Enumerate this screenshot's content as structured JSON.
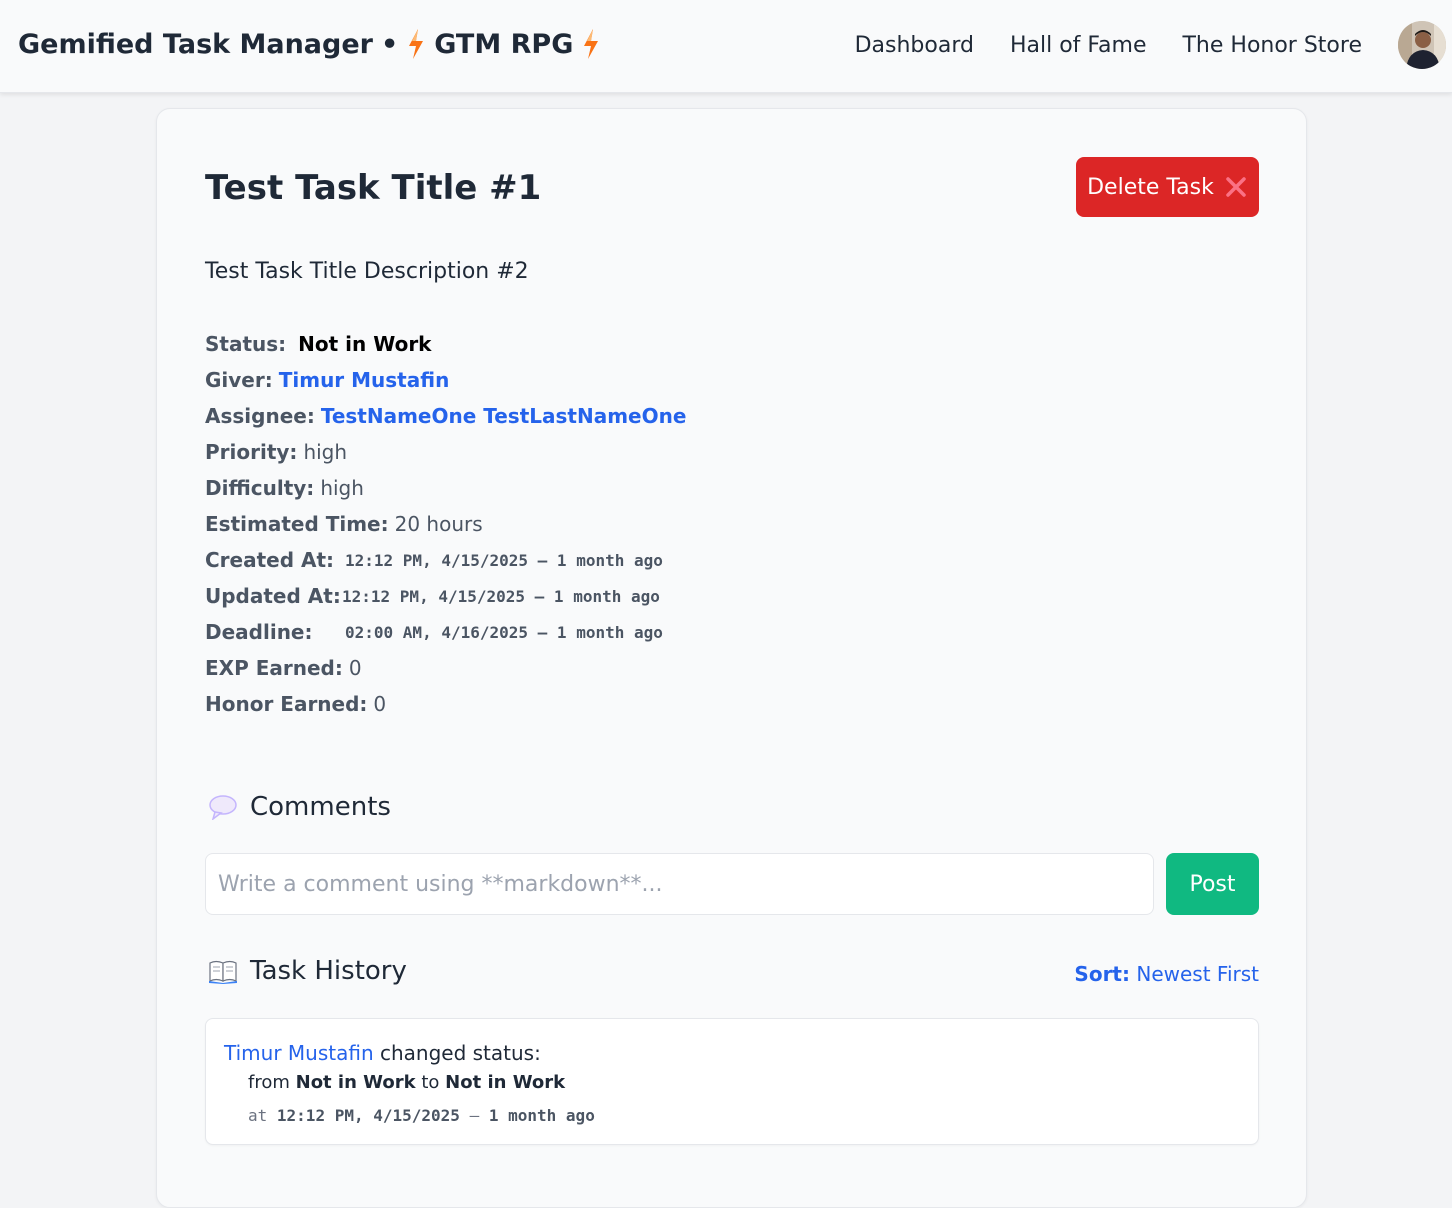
{
  "navbar": {
    "brand_main": "Gemified Task Manager",
    "brand_separator": "•",
    "brand_sub": "GTM RPG",
    "links": [
      "Dashboard",
      "Hall of Fame",
      "The Honor Store"
    ],
    "bolt_icon": "lightning-bolt-icon",
    "bolt_color": "#f97316"
  },
  "task": {
    "title": "Test Task Title #1",
    "delete_label": "Delete Task",
    "delete_icon": "close-x-icon",
    "description": "Test Task Title Description #2",
    "fields": {
      "status_label": "Status:",
      "status_value": "Not in Work",
      "giver_label": "Giver:",
      "giver_value": "Timur Mustafin",
      "assignee_label": "Assignee:",
      "assignee_value": "TestNameOne TestLastNameOne",
      "priority_label": "Priority:",
      "priority_value": "high",
      "difficulty_label": "Difficulty:",
      "difficulty_value": "high",
      "estimated_label": "Estimated Time:",
      "estimated_value": "20 hours",
      "created_label": "Created At:",
      "created_value": "12:12 PM, 4/15/2025 — 1 month ago",
      "updated_label": "Updated At:",
      "updated_value": "12:12 PM, 4/15/2025 — 1 month ago",
      "deadline_label": "Deadline:",
      "deadline_value": "02:00 AM, 4/16/2025 — 1 month ago",
      "exp_label": "EXP Earned:",
      "exp_value": "0",
      "honor_label": "Honor Earned:",
      "honor_value": "0"
    }
  },
  "comments": {
    "heading": "Comments",
    "icon": "speech-bubble-icon",
    "placeholder": "Write a comment using **markdown**...",
    "value": "",
    "post_label": "Post"
  },
  "history": {
    "heading": "Task History",
    "icon": "open-book-icon",
    "sort_label": "Sort:",
    "sort_value": "Newest First",
    "entries": [
      {
        "user": "Timur Mustafin",
        "action": "changed status:",
        "from_word": "from",
        "from_value": "Not in Work",
        "to_word": "to",
        "to_value": "Not in Work",
        "at_word": "at",
        "time": "12:12 PM, 4/15/2025",
        "relative": "1 month ago"
      }
    ]
  },
  "colors": {
    "accent_link": "#2563eb",
    "delete": "#dc2626",
    "post": "#10b981",
    "background": "#f3f4f6"
  }
}
